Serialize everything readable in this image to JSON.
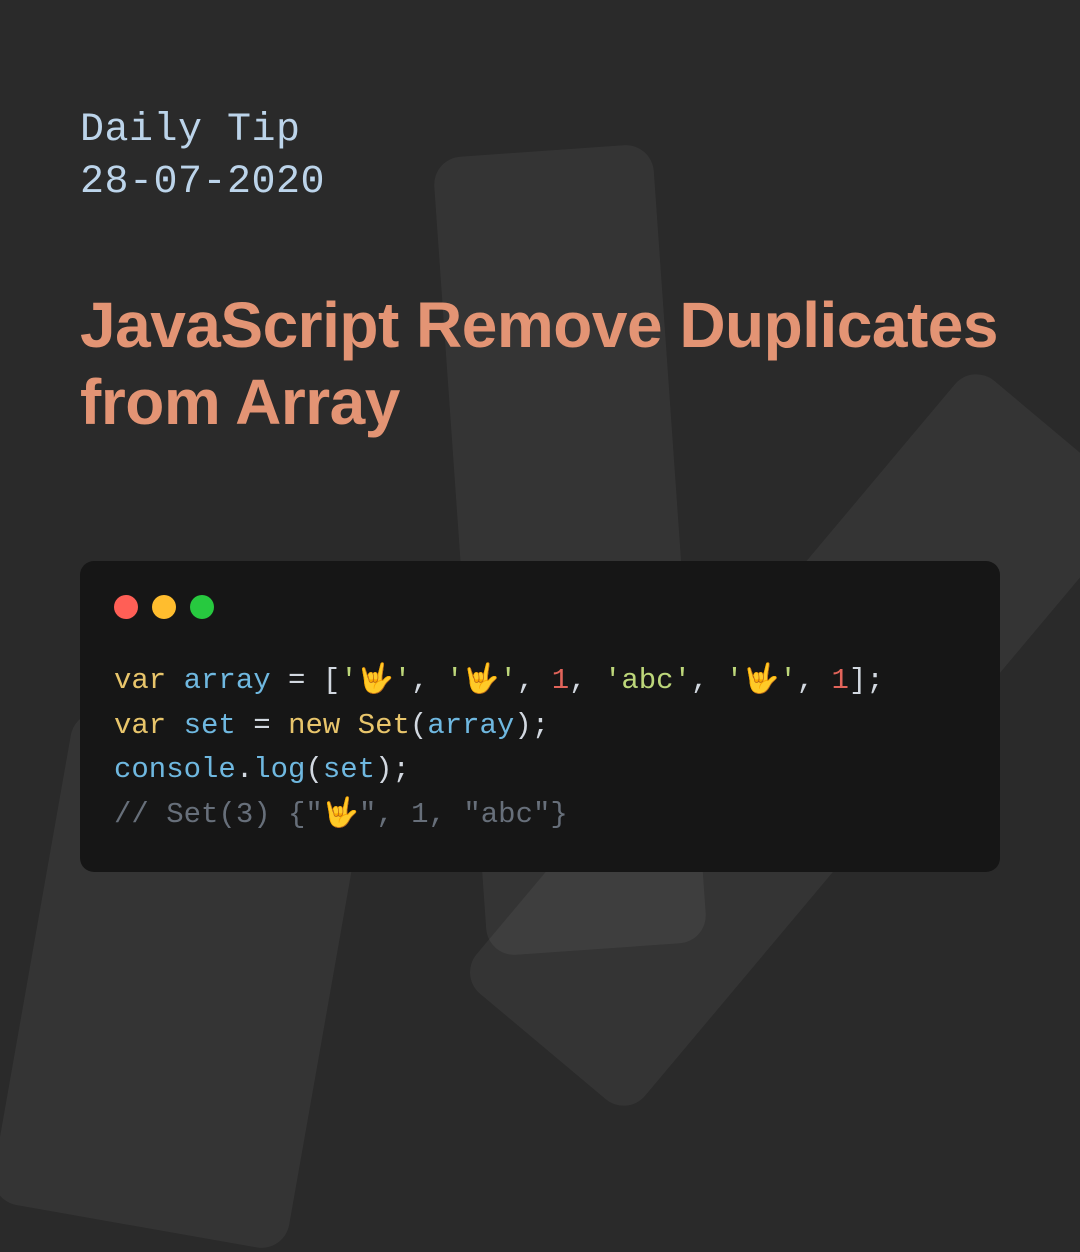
{
  "header": {
    "label": "Daily Tip",
    "date": "28-07-2020"
  },
  "title": "JavaScript Remove Duplicates from Array",
  "window": {
    "dot_colors": {
      "red": "#ff5f56",
      "yellow": "#ffbd2e",
      "green": "#27c93f"
    }
  },
  "code": {
    "line1": {
      "kw": "var",
      "id": "array",
      "eq": " = ",
      "lb": "[",
      "s1q1": "'",
      "s1": "🤟",
      "s1q2": "'",
      "c1": ", ",
      "s2q1": "'",
      "s2": "🤟",
      "s2q2": "'",
      "c2": ", ",
      "n1": "1",
      "c3": ", ",
      "s3q1": "'",
      "s3": "abc",
      "s3q2": "'",
      "c4": ", ",
      "s4q1": "'",
      "s4": "🤟",
      "s4q2": "'",
      "c5": ", ",
      "n2": "1",
      "rb": "];"
    },
    "line2": {
      "kw": "var",
      "id": "set",
      "eq": " = ",
      "new": "new",
      "sp": " ",
      "cls": "Set",
      "lp": "(",
      "arg": "array",
      "rp": ");"
    },
    "line3": {
      "obj": "console",
      "dot": ".",
      "fn": "log",
      "lp": "(",
      "arg": "set",
      "rp": ");"
    },
    "line4": {
      "cmt": "// Set(3) {\"🤟\", 1, \"abc\"}"
    }
  }
}
